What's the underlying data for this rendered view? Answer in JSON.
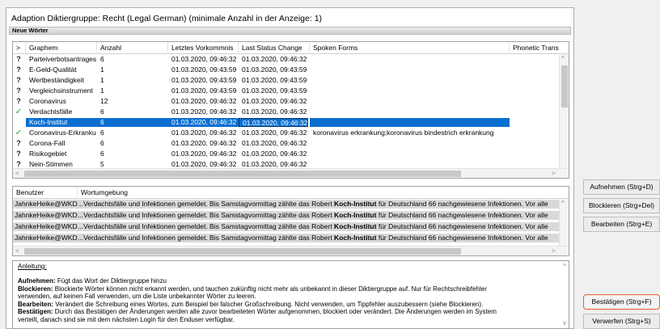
{
  "dialog": {
    "title": "Adaption Diktiergruppe: Recht (Legal German) (minimale Anzahl in der Anzeige: 1)",
    "section": "Neue Wörter"
  },
  "words_table": {
    "columns": [
      ">",
      "Graphem",
      "Anzahl",
      "Letztes Vorkommnis",
      "Last Status Change",
      "Spoken Forms",
      "Phonetic Trans"
    ],
    "rows": [
      {
        "status": "?",
        "graphem": "Parteiverbotsantrages",
        "anzahl": "6",
        "letztes": "01.03.2020, 09:46:32",
        "status_change": "01.03.2020, 09:46:32",
        "spoken": ""
      },
      {
        "status": "?",
        "graphem": "E-Geld-Qualität",
        "anzahl": "1",
        "letztes": "01.03.2020, 09:43:59",
        "status_change": "01.03.2020, 09:43:59",
        "spoken": ""
      },
      {
        "status": "?",
        "graphem": "Wertbeständigkeit",
        "anzahl": "1",
        "letztes": "01.03.2020, 09:43:59",
        "status_change": "01.03.2020, 09:43:59",
        "spoken": ""
      },
      {
        "status": "?",
        "graphem": "Vergleichsinstrument",
        "anzahl": "1",
        "letztes": "01.03.2020, 09:43:59",
        "status_change": "01.03.2020, 09:43:59",
        "spoken": ""
      },
      {
        "status": "?",
        "graphem": "Coronavirus",
        "anzahl": "12",
        "letztes": "01.03.2020, 09:46:32",
        "status_change": "01.03.2020, 09:46:32",
        "spoken": ""
      },
      {
        "status": "✓",
        "graphem": "Verdachtsfälle",
        "anzahl": "6",
        "letztes": "01.03.2020, 09:46:32",
        "status_change": "01.03.2020, 09:46:32",
        "spoken": ""
      },
      {
        "status": "",
        "graphem": "Koch-Institut",
        "anzahl": "6",
        "letztes": "01.03.2020, 09:46:32",
        "status_change": "01.03.2020, 09:46:32",
        "spoken": ""
      },
      {
        "status": "✓",
        "graphem": "Coronavirus-Erkranku",
        "anzahl": "6",
        "letztes": "01.03.2020, 09:46:32",
        "status_change": "01.03.2020, 09:46:32",
        "spoken": "koronavirus erkrankung;koronavirus bindestrich erkrankung"
      },
      {
        "status": "?",
        "graphem": "Corona-Fall",
        "anzahl": "6",
        "letztes": "01.03.2020, 09:46:32",
        "status_change": "01.03.2020, 09:46:32",
        "spoken": ""
      },
      {
        "status": "?",
        "graphem": "Risikogebiet",
        "anzahl": "6",
        "letztes": "01.03.2020, 09:46:32",
        "status_change": "01.03.2020, 09:46:32",
        "spoken": ""
      },
      {
        "status": "?",
        "graphem": "Nein-Stimmen",
        "anzahl": "5",
        "letztes": "01.03.2020, 09:46:32",
        "status_change": "01.03.2020, 09:46:32",
        "spoken": ""
      }
    ],
    "selected_row": "Koch-Institut"
  },
  "context_table": {
    "columns": [
      "Benutzer",
      "Wortumgebung"
    ],
    "rows": [
      {
        "user": "JahnkeHeike@WKD",
        "pre": "...Verdachtsfälle und Infektionen gemeldet. Bis Samstagvormittag zählte das Robert ",
        "word": "Koch-Institut",
        "post": " für Deutschland 66 nachgewiesene Infektionen. Vor alle"
      },
      {
        "user": "JahnkeHeike@WKD",
        "pre": "...Verdachtsfälle und Infektionen gemeldet. Bis Samstagvormittag zählte das Robert ",
        "word": "Koch-Institut",
        "post": " für Deutschland 66 nachgewiesene Infektionen. Vor alle"
      },
      {
        "user": "JahnkeHeike@WKD",
        "pre": "...Verdachtsfälle und Infektionen gemeldet. Bis Samstagvormittag zählte das Robert ",
        "word": "Koch-Institut",
        "post": " für Deutschland 66 nachgewiesene Infektionen. Vor alle"
      },
      {
        "user": "JahnkeHeike@WKD",
        "pre": "...Verdachtsfälle und Infektionen gemeldet. Bis Samstagvormittag zählte das Robert ",
        "word": "Koch-Institut",
        "post": " für Deutschland 66 nachgewiesene Infektionen. Vor alle"
      }
    ]
  },
  "instructions": {
    "heading": "Anleitung:",
    "lines": [
      {
        "key": "Aufnehmen:",
        "text": " Fügt das Wort der Diktiergruppe hinzu"
      },
      {
        "key": "Blockieren:",
        "text": " Blockierte Wörter können nicht erkannt werden, und tauchen zukünftig nicht mehr als unbekannt in dieser Diktiergruppe auf. Nur für Rechtschreibfehler"
      },
      {
        "key": "",
        "text": "verwenden, auf keinen Fall verwenden, um die Liste unbekannter Wörter zu leeren."
      },
      {
        "key": "Bearbeiten:",
        "text": " Verändert die Schreibung eines Wortes, zum Beispiel bei falscher Großschreibung. Nicht verwenden, um Tippfehler auszubessern (siehe Blockieren)."
      },
      {
        "key": "Bestätigen:",
        "text": " Durch das Bestätigen der Änderungen werden alle zuvor bearbeiteten Wörter aufgenommen, blockiert oder verändert. Die Änderungen werden im System"
      },
      {
        "key": "",
        "text": "verteilt, danach sind sie mit dem nächsten Login für den Enduser verfügbar."
      }
    ]
  },
  "buttons": {
    "aufnehmen": "Aufnehmen (Strg+D)",
    "blockieren": "Blockieren (Strg+Del)",
    "bearbeiten": "Bearbeiten (Strg+E)",
    "bestaetigen": "Bestätigen (Strg+F)",
    "verwerfen": "Verwerfen (Strg+S)"
  },
  "colors": {
    "selection": "#0a6fd0",
    "check": "#2d9a2d",
    "focus_border": "#e8602c"
  }
}
